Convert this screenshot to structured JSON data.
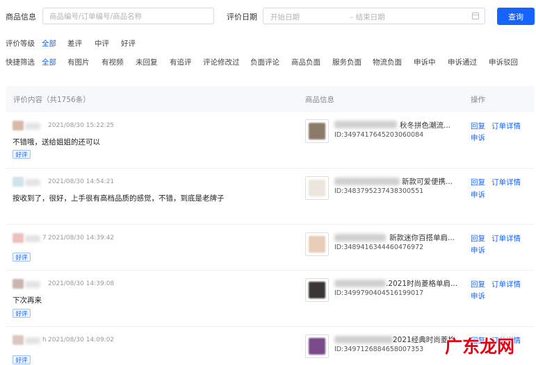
{
  "search": {
    "product_label": "商品信息",
    "product_placeholder": "商品编号/订单编号/商品名称",
    "date_label": "评价日期",
    "start_placeholder": "开始日期",
    "end_placeholder": "– 结束日期",
    "query_button": "查询"
  },
  "level_filter": {
    "label": "评价等级",
    "options": [
      "全部",
      "差评",
      "中评",
      "好评"
    ],
    "selected": "全部"
  },
  "quick_filter": {
    "label": "快捷筛选",
    "options": [
      "全部",
      "有图片",
      "有视频",
      "未回复",
      "有追评",
      "评论修改过",
      "负面评论",
      "商品负面",
      "服务负面",
      "物流负面",
      "申诉中",
      "申诉通过",
      "申诉驳回"
    ],
    "selected": "全部"
  },
  "table": {
    "header_content": "评价内容（共1756条）",
    "header_product": "商品信息",
    "header_action": "操作"
  },
  "actions": {
    "reply": "回复",
    "order_detail": "订单详情",
    "appeal": "申诉"
  },
  "rows": [
    {
      "user_suffix": "",
      "time": "2021/08/30 15:22:25",
      "content": "不错哦，送给姐姐的还可以",
      "tag": "好评",
      "product_title": "秋冬拼色潮流...",
      "product_id": "ID:3497417645203060084"
    },
    {
      "user_suffix": "",
      "time": "2021/08/30 14:54:21",
      "content": "按收到了，很好，上手很有高档品质的感觉，不错，到底是老牌子",
      "tag": "",
      "product_title": "新款可爱便携...",
      "product_id": "ID:3483795237438300551"
    },
    {
      "user_suffix": "7",
      "time": "2021/08/30 14:39:42",
      "content": "",
      "tag": "好评",
      "product_title": "新款迷你百搭单肩...",
      "product_id": "ID:3489416344460476972"
    },
    {
      "user_suffix": "",
      "time": "2021/08/30 14:39:08",
      "content": "下次再来",
      "tag": "好评",
      "product_title": ".2021时尚菱格单肩...",
      "product_id": "ID:3499790404516199017"
    },
    {
      "user_suffix": "h",
      "time": "2021/08/30 14:09:02",
      "content": "",
      "tag": "好评",
      "product_title": "2021经典时尚菱格",
      "product_id": "ID:3497126884658007353"
    }
  ],
  "watermark": "广东龙网"
}
